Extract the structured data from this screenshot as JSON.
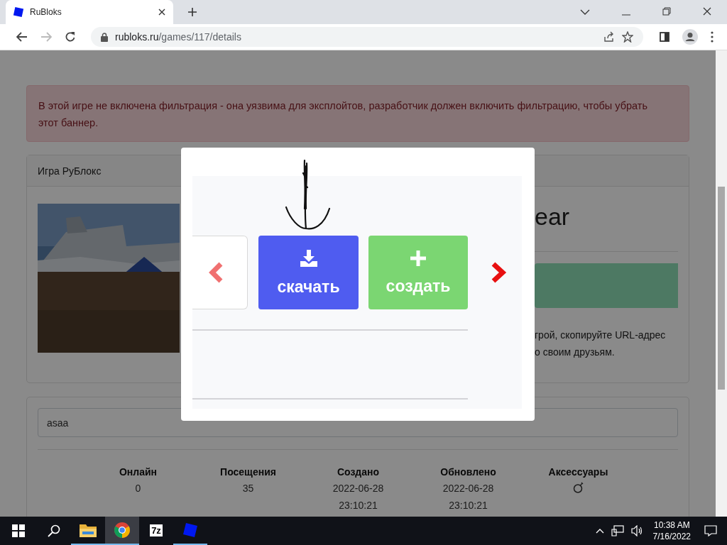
{
  "browser": {
    "tabs": [
      {
        "title": "RuBloks",
        "selected": true
      }
    ],
    "address": {
      "host": "rubloks.ru",
      "path": "/games/117/details"
    },
    "forward_disabled": true
  },
  "alert": {
    "text": "В этой игре не включена фильтрация - она уязвима для эксплойтов, разработчик должен включить фильтрацию, чтобы убрать этот баннер."
  },
  "game_card": {
    "header": "Игра РуБлокс",
    "title": "ear",
    "share_lines": [
      "грой, скопируйте URL-адрес",
      "о своим друзьям."
    ]
  },
  "modal": {
    "buttons": [
      {
        "kind": "download",
        "label": "скачать"
      },
      {
        "kind": "create",
        "label": "создать"
      }
    ]
  },
  "details": {
    "search_value": "asaa",
    "stats": [
      {
        "kind": "text",
        "label": "Онлайн",
        "lines": [
          "0"
        ]
      },
      {
        "kind": "text",
        "label": "Посещения",
        "lines": [
          "35"
        ]
      },
      {
        "kind": "text",
        "label": "Создано",
        "lines": [
          "2022-06-28",
          "23:10:21"
        ]
      },
      {
        "kind": "text",
        "label": "Обновлено",
        "lines": [
          "2022-06-28",
          "23:10:21"
        ]
      },
      {
        "kind": "icon",
        "label": "Аксессуары"
      }
    ]
  },
  "taskbar": {
    "apps": [
      {
        "kind": "explorer",
        "running": true,
        "selected": false
      },
      {
        "kind": "chrome",
        "running": true,
        "selected": true
      },
      {
        "kind": "archiver",
        "label": "7z",
        "running": false,
        "selected": false
      },
      {
        "kind": "blocks",
        "running": true,
        "selected": false
      }
    ],
    "time": "10:38 AM",
    "date": "7/16/2022"
  }
}
